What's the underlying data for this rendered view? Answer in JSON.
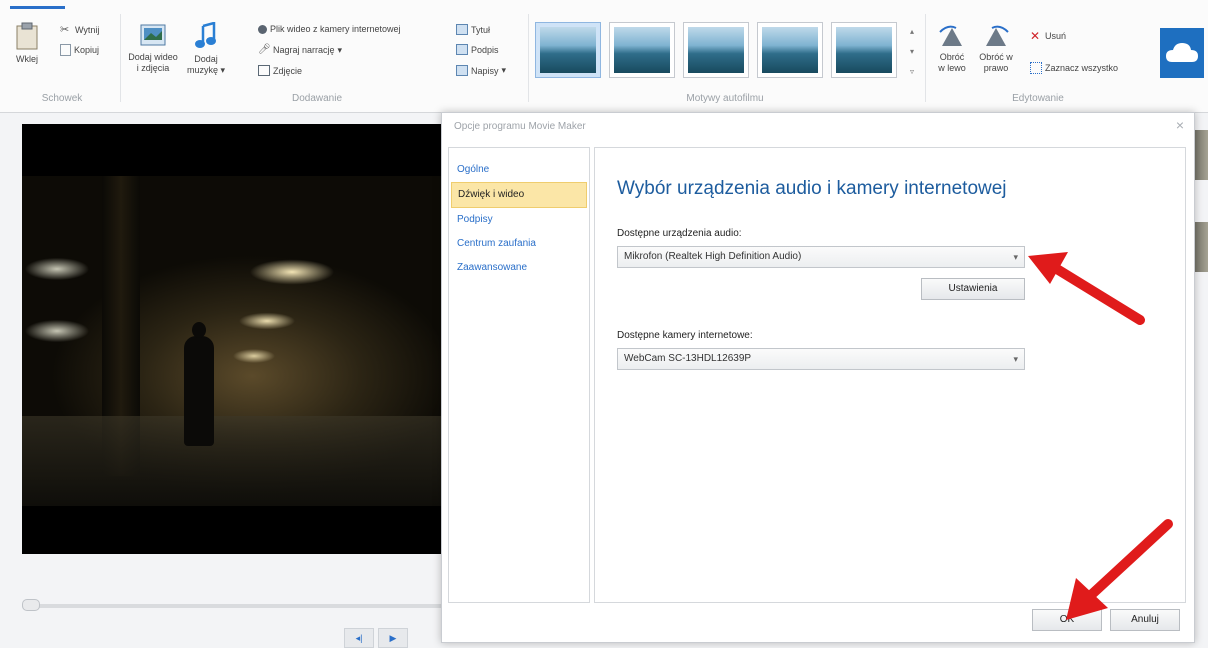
{
  "ribbon": {
    "clipboard": {
      "paste": "Wklej",
      "cut": "Wytnij",
      "copy": "Kopiuj",
      "group": "Schowek"
    },
    "add": {
      "add_video_photos_line1": "Dodaj wideo",
      "add_video_photos_line2": "i zdjęcia",
      "add_music_line1": "Dodaj",
      "add_music_line2": "muzykę",
      "webcam_video": "Plik wideo z kamery internetowej",
      "record_narration": "Nagraj narrację",
      "snapshot": "Zdjęcie",
      "title": "Tytuł",
      "caption": "Podpis",
      "credits": "Napisy",
      "group": "Dodawanie"
    },
    "themes_group": "Motywy autofilmu",
    "editing": {
      "rotate_left_line1": "Obróć",
      "rotate_left_line2": "w lewo",
      "rotate_right_line1": "Obróć w",
      "rotate_right_line2": "prawo",
      "remove": "Usuń",
      "select_all": "Zaznacz wszystko",
      "group": "Edytowanie"
    }
  },
  "dialog": {
    "title": "Opcje programu Movie Maker",
    "close": "×",
    "nav": [
      "Ogólne",
      "Dźwięk i wideo",
      "Podpisy",
      "Centrum zaufania",
      "Zaawansowane"
    ],
    "heading": "Wybór urządzenia audio i kamery internetowej",
    "audio_label": "Dostępne urządzenia audio:",
    "audio_value": "Mikrofon (Realtek High Definition Audio)",
    "settings_button": "Ustawienia",
    "webcam_label": "Dostępne kamery internetowe:",
    "webcam_value": "WebCam SC-13HDL12639P",
    "ok_button": "OK",
    "cancel_button": "Anuluj"
  },
  "colors": {
    "accent": "#2a6fc9",
    "heading": "#1d5c9e",
    "nav_active_bg": "#fbe6a7",
    "arrow": "#e01b1b"
  }
}
